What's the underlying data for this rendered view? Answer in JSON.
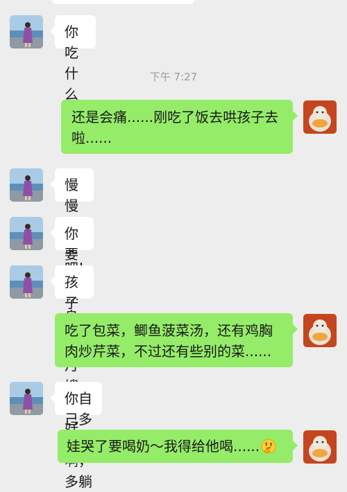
{
  "conversation": {
    "timestamp": "下午 7:27",
    "messages": [
      {
        "side": "in",
        "text": "你吃什么啊?",
        "emoji": "grin-emoji"
      },
      {
        "side": "out",
        "text": "还是会痛......刚吃了饭去哄孩子去啦......"
      },
      {
        "side": "in",
        "text": "慢慢恢复吧!"
      },
      {
        "side": "in",
        "text": "你要多休息啊!"
      },
      {
        "side": "in",
        "text": "孩子们等月嫂哄好啦!"
      },
      {
        "side": "out",
        "text": "吃了包菜，鲫鱼菠菜汤，还有鸡胸肉炒芹菜，不过还有些别的菜......"
      },
      {
        "side": "in",
        "text": "你自己多休息啊，多躺"
      },
      {
        "side": "out",
        "text": "娃哭了要喝奶～我得给他喝......",
        "emoji": "thinking-emoji"
      }
    ]
  },
  "colors": {
    "background": "#ededed",
    "incoming_bubble": "#ffffff",
    "outgoing_bubble": "#95ec69"
  }
}
